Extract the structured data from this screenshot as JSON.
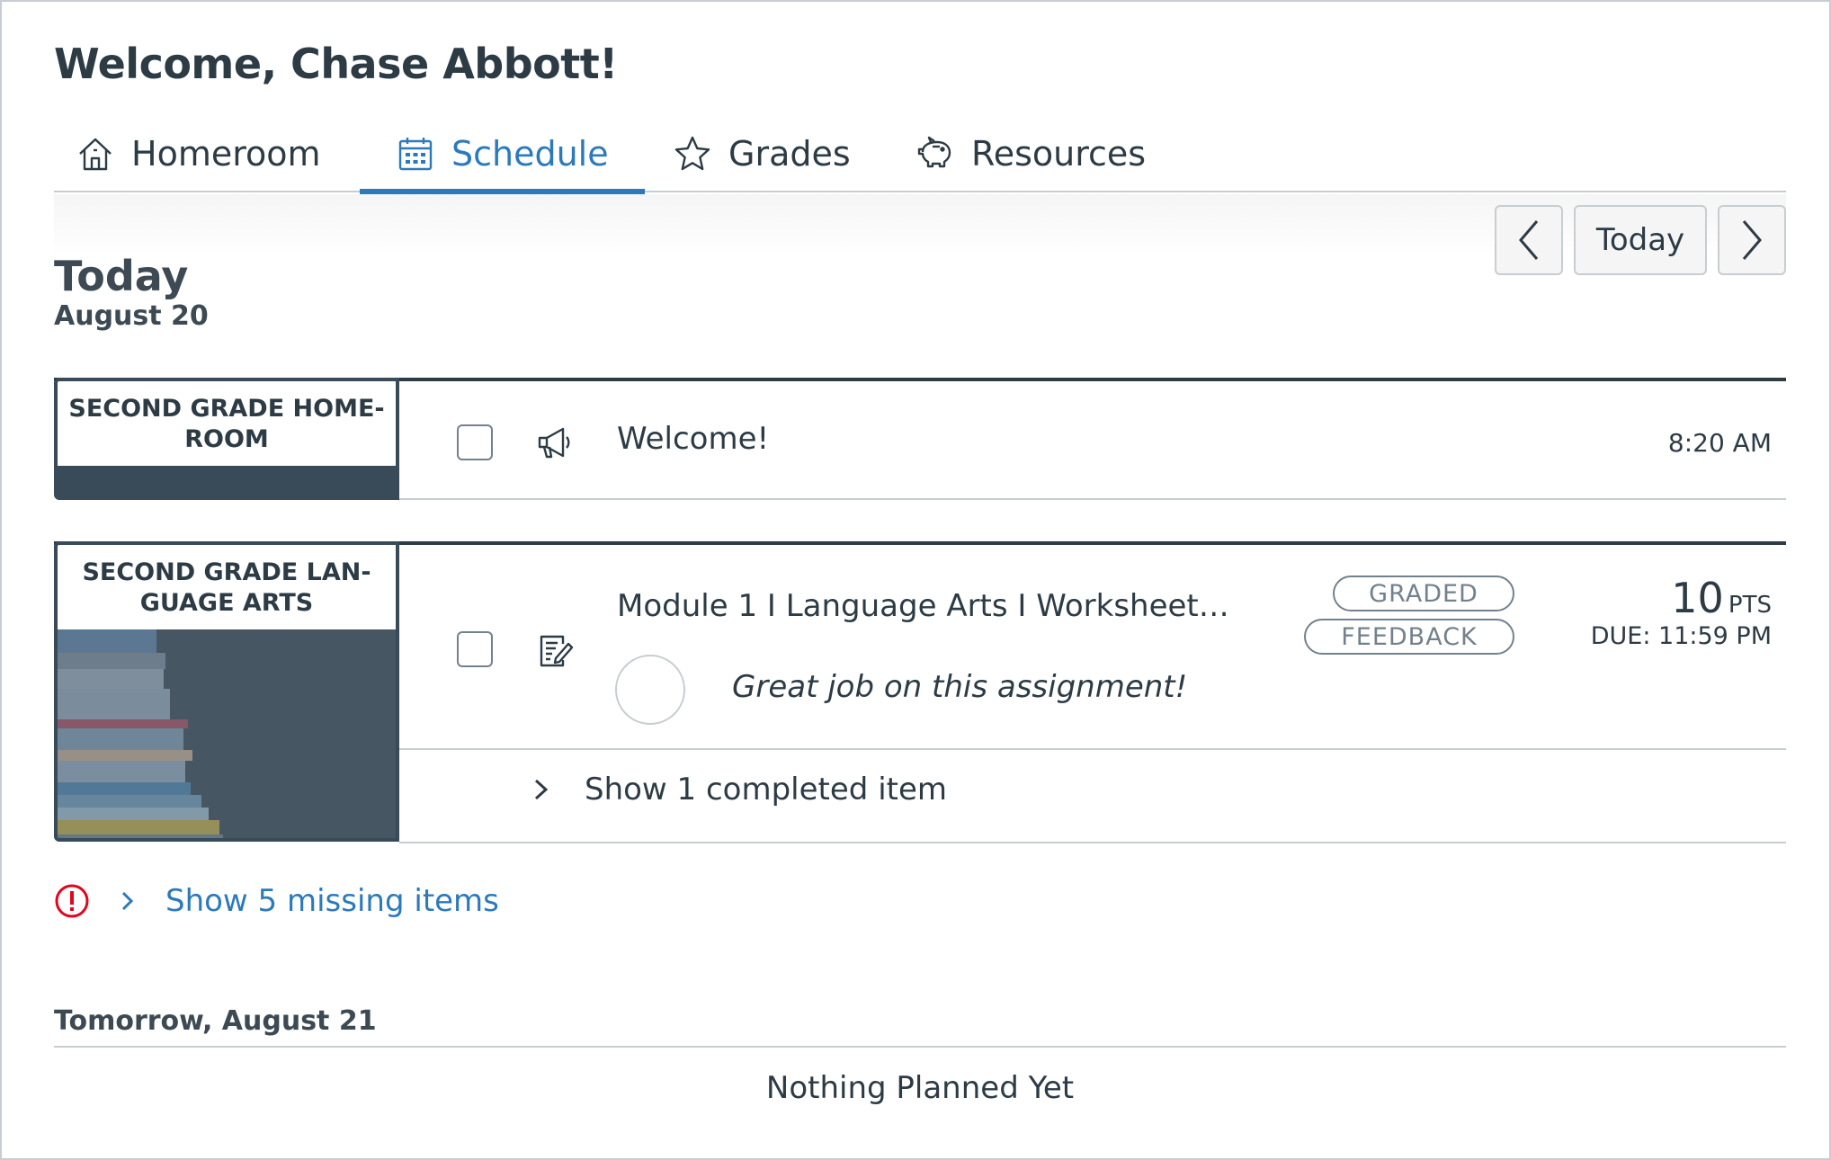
{
  "header": {
    "welcome": "Welcome, Chase Abbott!"
  },
  "tabs": [
    {
      "label": "Homeroom",
      "icon": "home-icon",
      "active": false
    },
    {
      "label": "Schedule",
      "icon": "calendar-icon",
      "active": true
    },
    {
      "label": "Grades",
      "icon": "star-icon",
      "active": false
    },
    {
      "label": "Resources",
      "icon": "piggy-bank-icon",
      "active": false
    }
  ],
  "nav": {
    "prev_icon": "chevron-left-icon",
    "today_label": "Today",
    "next_icon": "chevron-right-icon"
  },
  "today": {
    "title": "Today",
    "date": "August 20",
    "courses": [
      {
        "name": "SECOND GRADE HOME-ROOM",
        "name_line1": "SECOND GRADE HOME-",
        "name_line2": "ROOM",
        "items": [
          {
            "type_icon": "announcement-icon",
            "title": "Welcome!",
            "time": "8:20 AM"
          }
        ]
      },
      {
        "name": "SECOND GRADE LANGUAGE ARTS",
        "name_line1": "SECOND GRADE LAN-",
        "name_line2": "GUAGE ARTS",
        "items": [
          {
            "type_icon": "assignment-icon",
            "title": "Module 1 I Language Arts I Worksheet…",
            "badges": [
              "GRADED",
              "FEEDBACK"
            ],
            "points": "10",
            "points_unit": "PTS",
            "due": "DUE: 11:59 PM",
            "feedback": "Great job on this assignment!"
          }
        ],
        "completed_toggle": "Show 1 completed item"
      }
    ],
    "missing_items": "Show 5 missing items"
  },
  "tomorrow": {
    "title": "Tomorrow, August 21",
    "empty_text": "Nothing Planned Yet"
  },
  "colors": {
    "accent": "#2b7abc",
    "text": "#2d3b45",
    "border": "#c7cdd1",
    "danger": "#e0061f",
    "course_dark": "#394b58"
  }
}
